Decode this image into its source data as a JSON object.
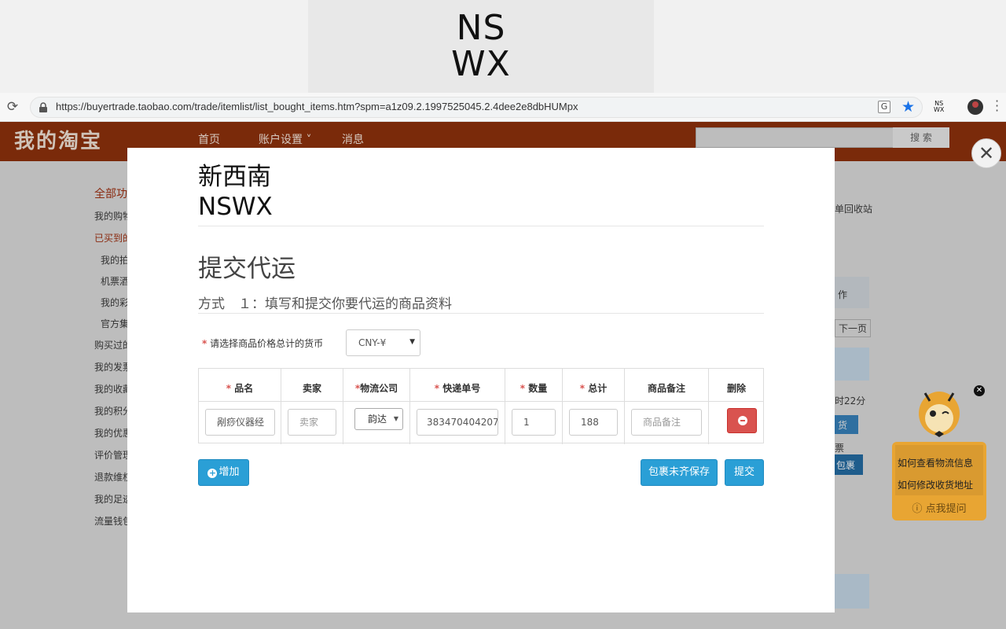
{
  "banner": {
    "line1": "NS",
    "line2": "WX"
  },
  "browser": {
    "url": "https://buyertrade.taobao.com/trade/itemlist/list_bought_items.htm?spm=a1z09.2.1997525045.2.4dee2e8dbHUMpx",
    "ext_label_line1": "NS",
    "ext_label_line2": "WX"
  },
  "taobao": {
    "logo": "我的淘宝",
    "nav": [
      "首页",
      "账户设置 ˅",
      "消息"
    ],
    "search_button": "搜 索",
    "sidebar": [
      "全部功",
      "我的购物",
      "已买到的",
      "我的拍",
      "机票酒",
      "我的彩",
      "官方集",
      "购买过的",
      "我的发票",
      "我的收藏",
      "我的积分",
      "我的优惠",
      "评价管理",
      "退款维权",
      "我的足迹",
      "流量钱包"
    ],
    "right_texts": [
      "单回收站",
      "作",
      "下一页",
      "时22分",
      "货",
      "票",
      "包裹"
    ]
  },
  "modal": {
    "brand_cn": "新西南",
    "brand_en": "NSWX",
    "title": "提交代运",
    "subtitle": "方式　１：填写和提交你要代运的商品资料",
    "currency_label": "请选择商品价格总计的货币",
    "currency_value": "CNY-¥",
    "table": {
      "headers": [
        "品名",
        "卖家",
        "物流公司",
        "快递单号",
        "数量",
        "总计",
        "商品备注",
        "删除"
      ],
      "required": [
        true,
        false,
        true,
        true,
        true,
        true,
        false,
        false
      ],
      "row": {
        "item_name": "剐痧仪器经",
        "seller_placeholder": "卖家",
        "carrier": "韵达",
        "tracking_no": "383470404207",
        "quantity": "1",
        "total": "188",
        "note_placeholder": "商品备注"
      }
    },
    "add_label": "增加",
    "save_label": "包裹未齐保存",
    "submit_label": "提交"
  },
  "help": {
    "q1": "如何查看物流信息",
    "q2": "如何修改收货地址",
    "ask": "点我提问"
  },
  "colors": {
    "accent": "#2a9fd6",
    "danger": "#d9534f",
    "header": "#7a2a0a"
  }
}
